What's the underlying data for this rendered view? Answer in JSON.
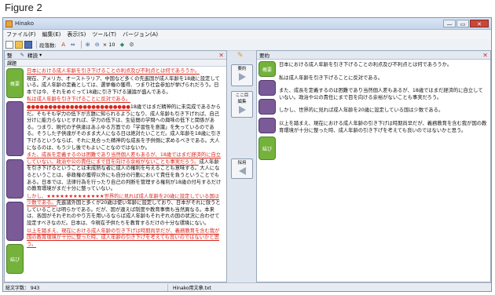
{
  "figure_label": "Figure 2",
  "window": {
    "title": "Hinako",
    "min": "—",
    "max": "▭",
    "close": "✕"
  },
  "menu": [
    "ファイル(F)",
    "編集(E)",
    "表示(S)",
    "ツール(T)",
    "バージョン(A)"
  ],
  "toolbar": {
    "size_label": "段落数:",
    "zoom": "× 10"
  },
  "left_panel": {
    "header_label": "整",
    "sub_label": "課題",
    "mode_label": "精読",
    "tabs": {
      "top": "概要",
      "bottom": "結び"
    },
    "paragraphs": [
      {
        "parts": [
          {
            "t": "日本における成人年齢を引き下げることの利点及び不利点とは何であろうか。",
            "c": "red"
          }
        ]
      },
      {
        "parts": [
          {
            "t": "現在、アメリカ、オーストラリア、中国など多くの先進国が成人年齢を18歳に設定している。成人年齢の定義としては、選挙権の獲得、つまり社会参加が挙げられだろう。日本では今、それをめぐって18歳に引き下げる議論が盛んである。",
            "c": ""
          }
        ]
      },
      {
        "parts": [
          {
            "t": "私は成人年齢を引き下げることに反対である。",
            "c": "red"
          }
        ]
      },
      {
        "parts": [
          {
            "t": "●●●●●●●●●●●●●●●●●●●●●●●●",
            "c": "red"
          },
          {
            "t": "18歳ではまだ精神的に未完成であるからだ。そもそも学力の低下が言題に知られるようになり、成人年齢も引き下げれば、自己分けに能力らないとすれば、学力の低下は、生徒間の学問への興味の低下と関係がある。つまり、現代の子供達はあふゆる方面での「学習性を意識」を失っているのである。そうした子供達がそのまま大人になる日は絶対たいことだ。成人年齢を18歳に引き下げるというならば、それに見合った精神的な成長を子供側に求めるべきである。大人になるのは、もう少し後でもよいことなのではないか。",
            "c": ""
          }
        ]
      },
      {
        "parts": [
          {
            "t": "また、成長を定義するのは困難であり当然個人差もあるが、18歳ではまだ経済的に自立していない。政治や公の責任にまで目を向ける余裕がないことも事実だろう。",
            "c": "red"
          },
          {
            "t": "成人年齢を引き下げるということは未成熟な者に成人の権利を与えることも意味する。大人になるということは、参政権の獲得以外にも自分の行動において責任を負うということでもある。日本では、法律行為を行ったり自己の判断を管理する権利が18歳の付与するだけの教育環境がまだ十分に整っていない。",
            "c": ""
          }
        ]
      },
      {
        "parts": [
          {
            "t": "しかし、★★★★★★★★★★★★★世界的に見れば成人年齢を20歳に設定している国は少数である。",
            "c": "red"
          },
          {
            "t": "先進諸外国と多くが20歳は使い年齢に設定しており、日本がそれに倣うとしていることは明らかである。だが、国が違えば制度や教育事情も当然異なる。本来は、各国がそれぞれのやり方を用いるならば成人年齢もそれぞれの国の状況に合わせて設定すべきなのだ。日本は、今現在子供たちを教育するだけの十分な環境にない。",
            "c": ""
          }
        ]
      },
      {
        "parts": [
          {
            "t": "以上を踏まえ、現在における成人年齢の引き下げは時期尚早だが、義務教育を含む我が国の教育環境が十分に整った時、成人年齢の引き下げを考えても良いのではないかと思う。",
            "c": "red"
          }
        ]
      }
    ]
  },
  "middle": {
    "btn1": "要約",
    "btn2_a": "ここ目",
    "btn2_b": "編集",
    "btn3": "採用"
  },
  "right_panel": {
    "header_label": "要約",
    "tabs": {
      "top": "概要",
      "bottom": "結び"
    },
    "paragraphs": [
      "日本における成人年齢を引き下げることの利点及び不利点とは何であろうか。",
      "私は成人年齢を引き下げることに反対である。",
      "また、成長を定義するのは困難であり当然個人差もあるが、18歳ではまだ経済的に自立していない。政治や公の責任にまで目を向ける余裕がないことも事実だろう。",
      "しかし、世界的に見れば成人年齢を20歳に設定している国は少数である。",
      "以上を踏まえ、現在における成人年齢の引き下げは時期尚早だが、義務教育を含む我が国の教育環境が十分に整った時、成人年齢の引き下げを考えても良いのではないかと思う。"
    ]
  },
  "status": {
    "chars": "総文字数： 943",
    "file": "Hinako用文章.txt"
  }
}
